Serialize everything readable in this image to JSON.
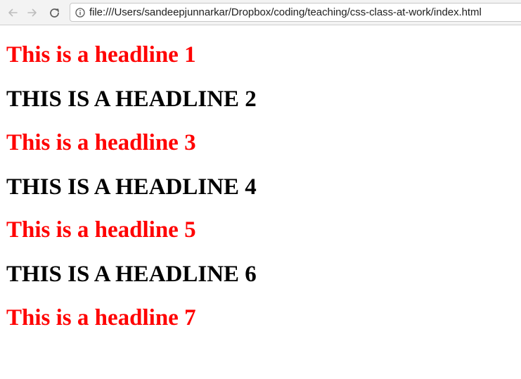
{
  "browser": {
    "url": "file:///Users/sandeepjunnarkar/Dropbox/coding/teaching/css-class-at-work/index.html",
    "icons": {
      "back": "back-arrow-icon",
      "forward": "forward-arrow-icon",
      "reload": "reload-icon",
      "info": "info-icon"
    }
  },
  "colors": {
    "red_headline": "#ff0000",
    "black_headline": "#000000"
  },
  "headlines": [
    {
      "text": "This is a headline 1",
      "color": "red"
    },
    {
      "text": "THIS IS A HEADLINE 2",
      "color": "black"
    },
    {
      "text": "This is a headline 3",
      "color": "red"
    },
    {
      "text": "THIS IS A HEADLINE 4",
      "color": "black"
    },
    {
      "text": "This is a headline 5",
      "color": "red"
    },
    {
      "text": "THIS IS A HEADLINE 6",
      "color": "black"
    },
    {
      "text": "This is a headline 7",
      "color": "red"
    }
  ]
}
